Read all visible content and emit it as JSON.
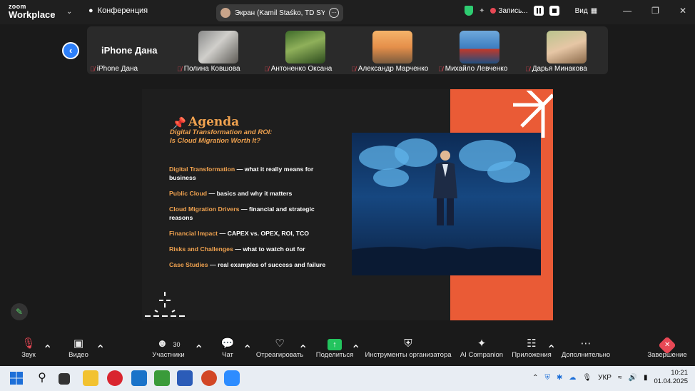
{
  "app": {
    "logo_line1": "zoom",
    "logo_line2": "Workplace",
    "meeting_label": "Конференция",
    "share_label": "Экран (Kamil Staśko, TD SYNNEX",
    "record_label": "Запись...",
    "view_label": "Вид"
  },
  "strip": {
    "host_name": "iPhone Дана",
    "participants": [
      {
        "name": "iPhone Дана"
      },
      {
        "name": "Полина Ковшова"
      },
      {
        "name": "Антоненко Оксана"
      },
      {
        "name": "Александр Марченко"
      },
      {
        "name": "Михайло Левченко"
      },
      {
        "name": "Дарья Минакова"
      }
    ]
  },
  "slide": {
    "title": "Agenda",
    "subtitle_line1": "Digital Transformation and ROI:",
    "subtitle_line2": "Is Cloud Migration Worth It?",
    "items": [
      {
        "head": "Digital Transformation",
        "rest": " — what it really means for business"
      },
      {
        "head": "Public Cloud",
        "rest": " — basics and why it matters"
      },
      {
        "head": "Cloud Migration Drivers",
        "rest": " — financial and strategic reasons"
      },
      {
        "head": "Financial Impact",
        "rest": " — CAPEX vs. OPEX, ROI, TCO"
      },
      {
        "head": "Risks and Challenges",
        "rest": " — what to watch out for"
      },
      {
        "head": "Case Studies",
        "rest": " — real examples of success and failure"
      }
    ]
  },
  "toolbar": {
    "audio": "Звук",
    "video": "Видео",
    "participants": "Участники",
    "participants_count": "30",
    "chat": "Чат",
    "react": "Отреагировать",
    "share": "Поделиться",
    "host_tools": "Инструменты организатора",
    "ai": "AI Companion",
    "apps": "Приложения",
    "more": "Дополнительно",
    "end": "Завершение"
  },
  "taskbar": {
    "lang": "УКР",
    "time": "10:21",
    "date": "01.04.2025"
  },
  "colors": {
    "accent_blue": "#2d7ff9",
    "slide_orange": "#ea5b36",
    "agenda_orange": "#f0a24f",
    "mute_red": "#e84855",
    "share_green": "#23c45e"
  }
}
